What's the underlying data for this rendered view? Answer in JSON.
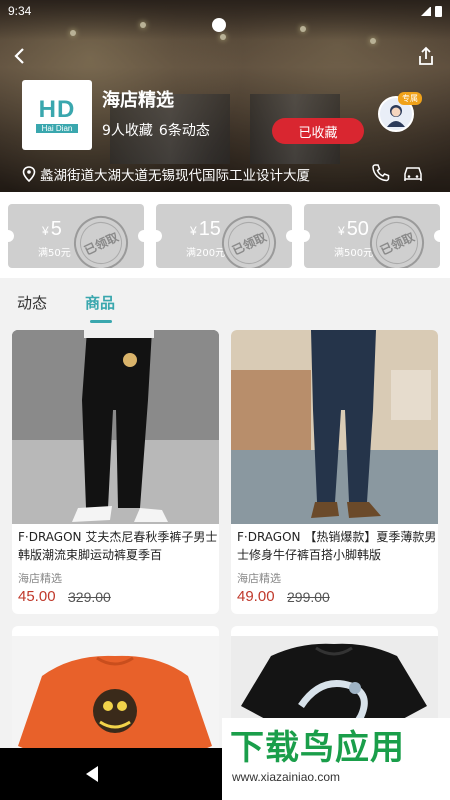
{
  "status_bar": {
    "time": "9:34"
  },
  "shop": {
    "logo_main": "HD",
    "logo_sub": "Hai Dian",
    "name": "海店精选",
    "favorites": "9人收藏",
    "posts": "6条动态",
    "favorite_button": "已收藏",
    "service_badge": "专属",
    "address": "蠡湖街道大湖大道无锡现代国际工业设计大厦"
  },
  "coupons": [
    {
      "currency": "¥",
      "amount": "5",
      "condition": "满50元",
      "stamp": "已领取"
    },
    {
      "currency": "¥",
      "amount": "15",
      "condition": "满200元",
      "stamp": "已领取"
    },
    {
      "currency": "¥",
      "amount": "50",
      "condition": "满500元",
      "stamp": "已领取"
    }
  ],
  "tabs": [
    {
      "label": "动态",
      "active": false
    },
    {
      "label": "商品",
      "active": true
    }
  ],
  "products": [
    {
      "title": "F·DRAGON 艾夫杰尼春秋季裤子男士韩版潮流束脚运动裤夏季百",
      "shop": "海店精选",
      "price": "45.00",
      "old_price": "329.00"
    },
    {
      "title": "F·DRAGON 【热销爆款】夏季薄款男士修身牛仔裤百搭小脚韩版",
      "shop": "海店精选",
      "price": "49.00",
      "old_price": "299.00"
    },
    {
      "title": "",
      "shop": "",
      "price": "",
      "old_price": ""
    },
    {
      "title": "",
      "shop": "",
      "price": "",
      "old_price": ""
    }
  ],
  "watermark": {
    "brand": "下载鸟应用",
    "url": "www.xiazainiao.com"
  },
  "colors": {
    "accent": "#3aa7ae",
    "favorite_button": "#d92630",
    "price": "#c0392b",
    "watermark": "#1a9e4a"
  },
  "icons": [
    "back-arrow-icon",
    "share-icon",
    "location-pin-icon",
    "phone-icon",
    "car-icon",
    "customer-service-icon"
  ]
}
